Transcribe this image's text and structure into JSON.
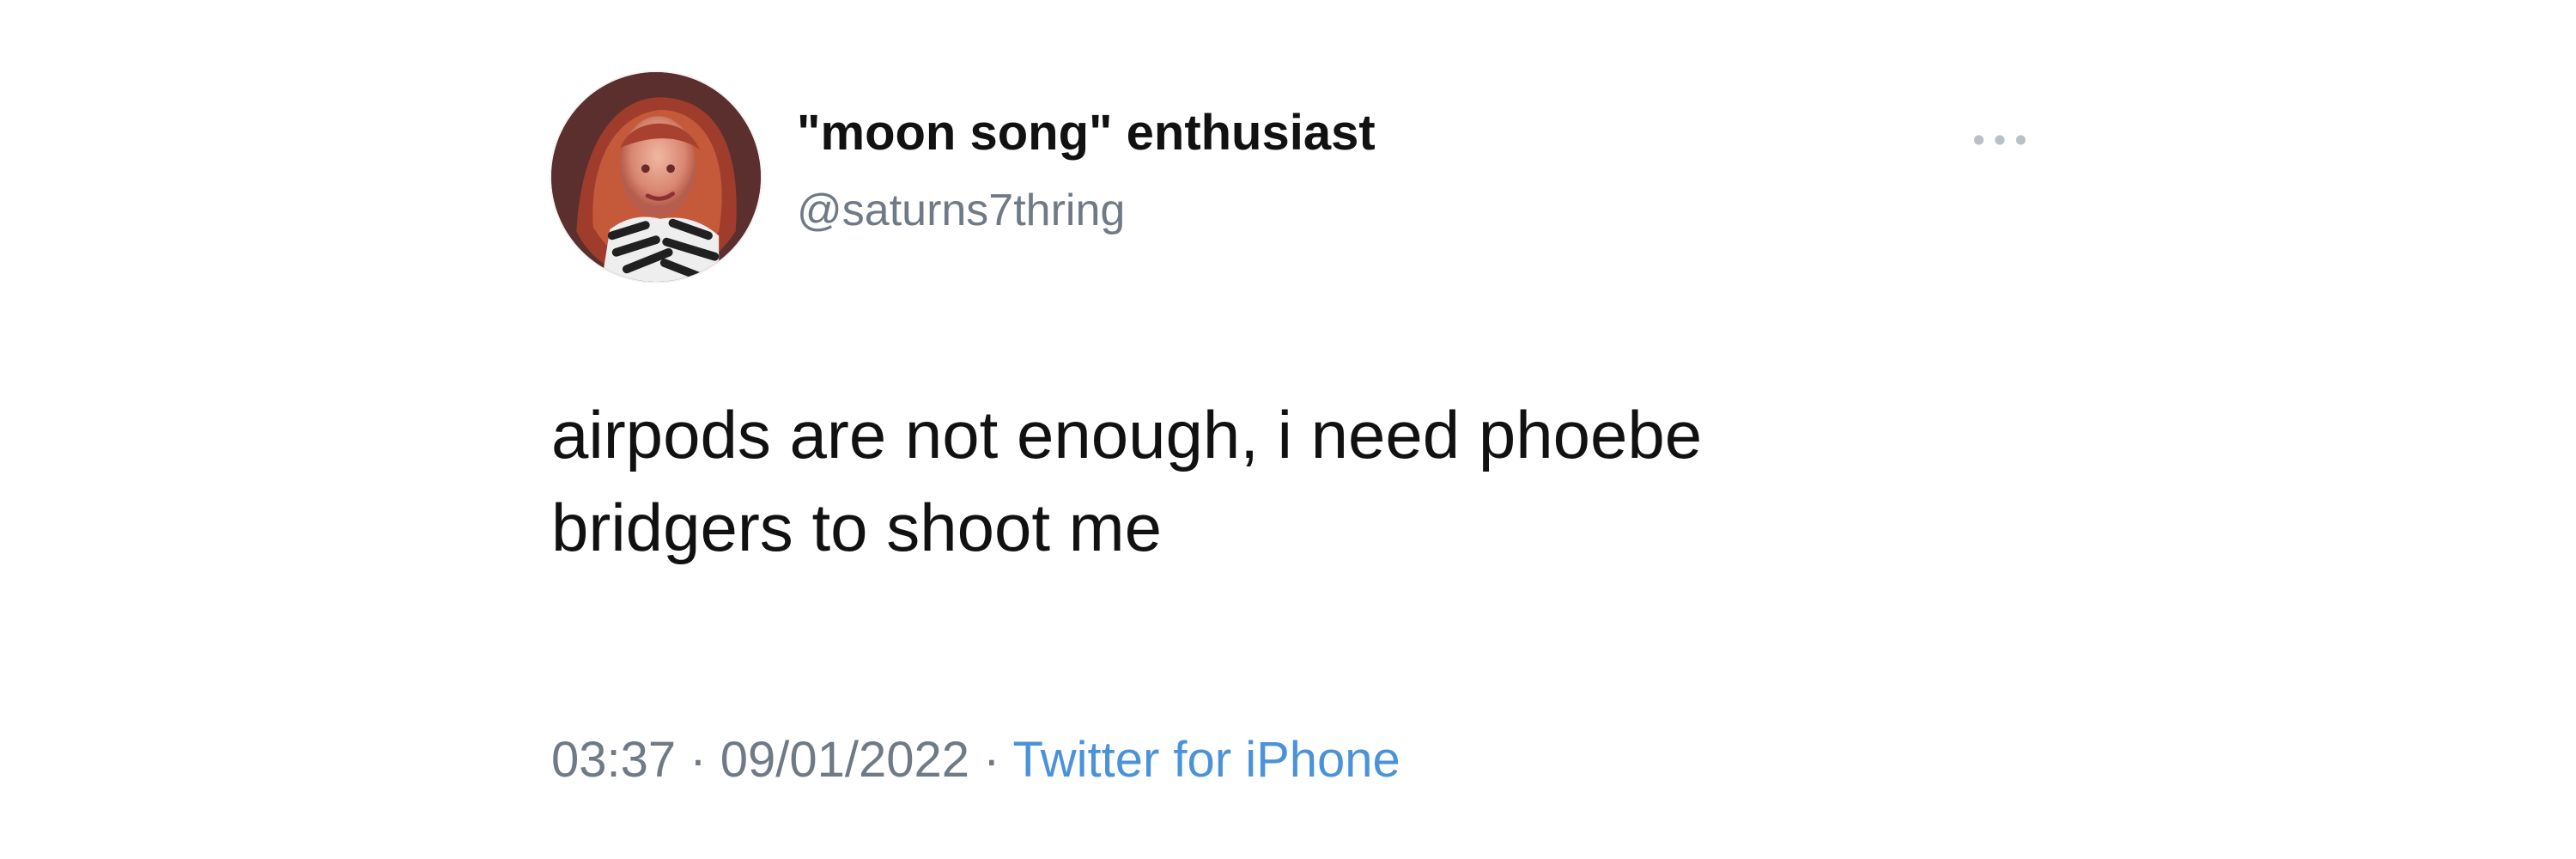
{
  "tweet": {
    "display_name": "\"moon song\" enthusiast",
    "handle": "@saturns7thring",
    "text": "airpods are not enough, i need phoebe\nbridgers to shoot me",
    "time": "03:37",
    "date": "09/01/2022",
    "source": "Twitter for iPhone",
    "separator": " · "
  },
  "icons": {
    "avatar": "avatar",
    "more": "more-icon"
  },
  "colors": {
    "primary_text": "#111111",
    "secondary_text": "#6f7a86",
    "link": "#4a93d9",
    "muted_icon": "#b9c0c7"
  }
}
